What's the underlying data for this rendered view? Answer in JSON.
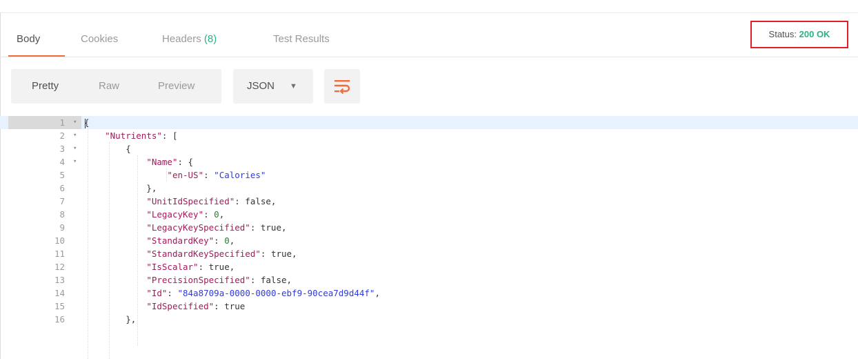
{
  "tabs": [
    {
      "label": "Body",
      "active": true
    },
    {
      "label": "Cookies",
      "active": false
    },
    {
      "label": "Headers",
      "count": "(8)",
      "active": false
    },
    {
      "label": "Test Results",
      "active": false
    }
  ],
  "status": {
    "label": "Status:",
    "value": "200 OK"
  },
  "view_modes": [
    {
      "label": "Pretty",
      "active": true
    },
    {
      "label": "Raw",
      "active": false
    },
    {
      "label": "Preview",
      "active": false
    }
  ],
  "format": {
    "label": "JSON",
    "caret_icon": "▼"
  },
  "wrap_icon": "wrap-lines-icon",
  "colors": {
    "accent": "#f26b3a",
    "success": "#26b47f",
    "highlight_border": "#e01f26",
    "key": "#a3195b",
    "string": "#2f3bd6"
  },
  "code_lines": [
    {
      "n": "1",
      "fold": true,
      "text": "{"
    },
    {
      "n": "2",
      "fold": true,
      "text": "    \"Nutrients\": ["
    },
    {
      "n": "3",
      "fold": true,
      "text": "        {"
    },
    {
      "n": "4",
      "fold": true,
      "text": "            \"Name\": {"
    },
    {
      "n": "5",
      "fold": false,
      "text": "                \"en-US\": \"Calories\""
    },
    {
      "n": "6",
      "fold": false,
      "text": "            },"
    },
    {
      "n": "7",
      "fold": false,
      "text": "            \"UnitIdSpecified\": false,"
    },
    {
      "n": "8",
      "fold": false,
      "text": "            \"LegacyKey\": 0,"
    },
    {
      "n": "9",
      "fold": false,
      "text": "            \"LegacyKeySpecified\": true,"
    },
    {
      "n": "10",
      "fold": false,
      "text": "            \"StandardKey\": 0,"
    },
    {
      "n": "11",
      "fold": false,
      "text": "            \"StandardKeySpecified\": true,"
    },
    {
      "n": "12",
      "fold": false,
      "text": "            \"IsScalar\": true,"
    },
    {
      "n": "13",
      "fold": false,
      "text": "            \"PrecisionSpecified\": false,"
    },
    {
      "n": "14",
      "fold": false,
      "text": "            \"Id\": \"84a8709a-0000-0000-ebf9-90cea7d9d44f\","
    },
    {
      "n": "15",
      "fold": false,
      "text": "            \"IdSpecified\": true"
    },
    {
      "n": "16",
      "fold": false,
      "text": "        },"
    }
  ]
}
